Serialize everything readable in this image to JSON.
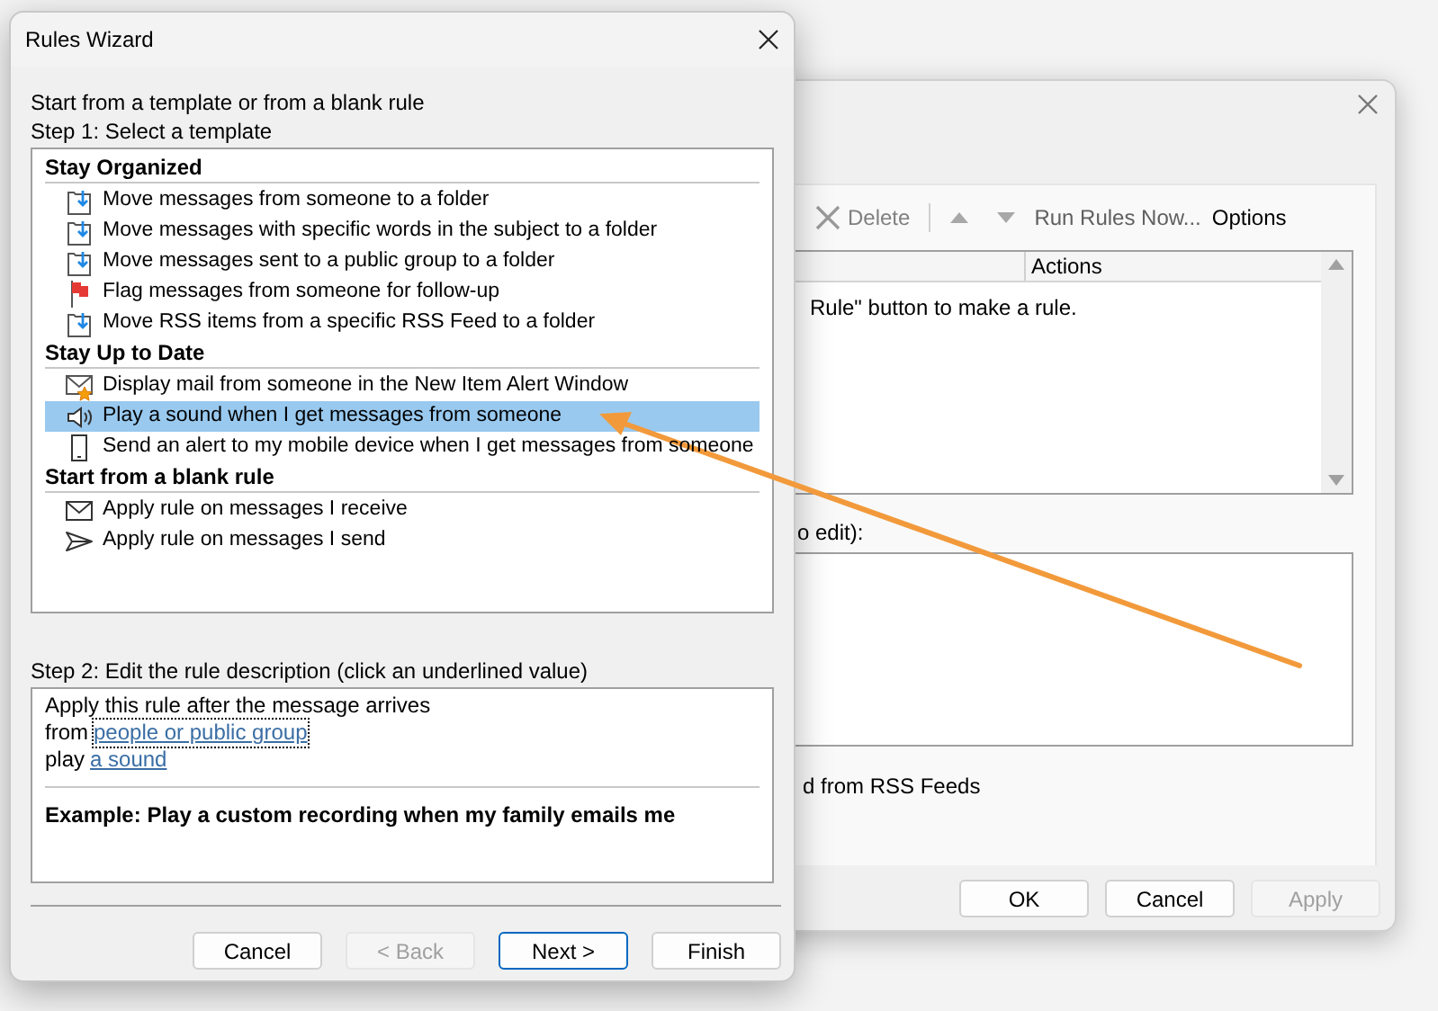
{
  "rules_window": {
    "toolbar": {
      "delete_label": "Delete",
      "run_rules_label": "Run Rules Now...",
      "options_label": "Options"
    },
    "rules_list": {
      "columns": [
        "Actions"
      ],
      "message": "Rule\" button to make a rule."
    },
    "description_label": "o edit):",
    "rss_label": "d from RSS Feeds",
    "buttons": [
      {
        "label": "OK",
        "disabled": false
      },
      {
        "label": "Cancel",
        "disabled": false
      },
      {
        "label": "Apply",
        "disabled": true
      }
    ]
  },
  "rules_wizard": {
    "title": "Rules Wizard",
    "intro": "Start from a template or from a blank rule",
    "step1_label": "Step 1: Select a template",
    "template_groups": [
      {
        "heading": "Stay Organized",
        "items": [
          {
            "kind": "move",
            "label": "Move messages from someone to a folder",
            "selected": false
          },
          {
            "kind": "move",
            "label": "Move messages with specific words in the subject to a folder",
            "selected": false
          },
          {
            "kind": "move",
            "label": "Move messages sent to a public group to a folder",
            "selected": false
          },
          {
            "kind": "flag",
            "label": "Flag messages from someone for follow-up",
            "selected": false
          },
          {
            "kind": "move",
            "label": "Move RSS items from a specific RSS Feed to a folder",
            "selected": false
          }
        ]
      },
      {
        "heading": "Stay Up to Date",
        "items": [
          {
            "kind": "alert",
            "label": "Display mail from someone in the New Item Alert Window",
            "selected": false
          },
          {
            "kind": "sound",
            "label": "Play a sound when I get messages from someone",
            "selected": true
          },
          {
            "kind": "mobile",
            "label": "Send an alert to my mobile device when I get messages from someone",
            "selected": false
          }
        ]
      },
      {
        "heading": "Start from a blank rule",
        "items": [
          {
            "kind": "mail",
            "label": "Apply rule on messages I receive",
            "selected": false
          },
          {
            "kind": "send",
            "label": "Apply rule on messages I send",
            "selected": false
          }
        ]
      }
    ],
    "step2_label": "Step 2: Edit the rule description (click an underlined value)",
    "description_lines": [
      {
        "text": "Apply this rule after the message arrives"
      },
      {
        "text": "from",
        "link": "people or public group",
        "focused": true
      },
      {
        "text": "play",
        "link": "a sound",
        "focused": false
      }
    ],
    "example": "Example: Play a custom recording when my family emails me",
    "buttons": [
      {
        "label": "Cancel",
        "disabled": false,
        "default": false
      },
      {
        "label": "< Back",
        "disabled": true,
        "default": false
      },
      {
        "label": "Next >",
        "disabled": false,
        "default": true
      },
      {
        "label": "Finish",
        "disabled": false,
        "default": false
      }
    ]
  }
}
